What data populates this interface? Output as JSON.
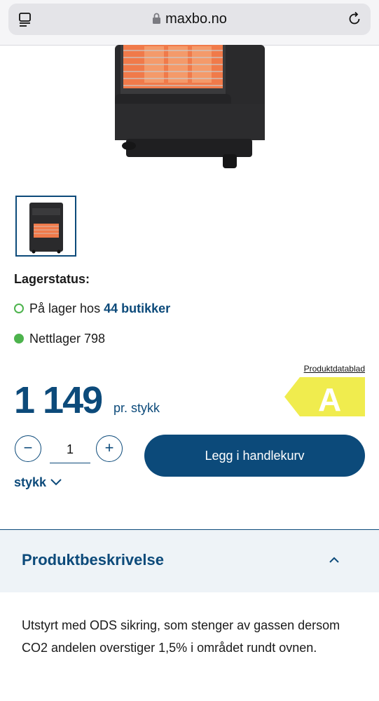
{
  "browser": {
    "url": "maxbo.no"
  },
  "stock": {
    "title": "Lagerstatus:",
    "store_prefix": "På lager hos ",
    "store_link": "44 butikker",
    "online": "Nettlager 798"
  },
  "energy": {
    "datasheet_label": "Produktdatablad",
    "class": "A",
    "color": "#f0ec4e"
  },
  "price": {
    "amount": "1 149",
    "unit_label": "pr. stykk"
  },
  "cart": {
    "quantity": "1",
    "add_label": "Legg i handlekurv",
    "unit": "stykk"
  },
  "description": {
    "header": "Produktbeskrivelse",
    "text": "Utstyrt med ODS sikring, som stenger av gassen dersom CO2 andelen overstiger 1,5% i området rundt ovnen."
  },
  "colors": {
    "brand": "#0c4a7a",
    "stock_green": "#4db34d"
  }
}
